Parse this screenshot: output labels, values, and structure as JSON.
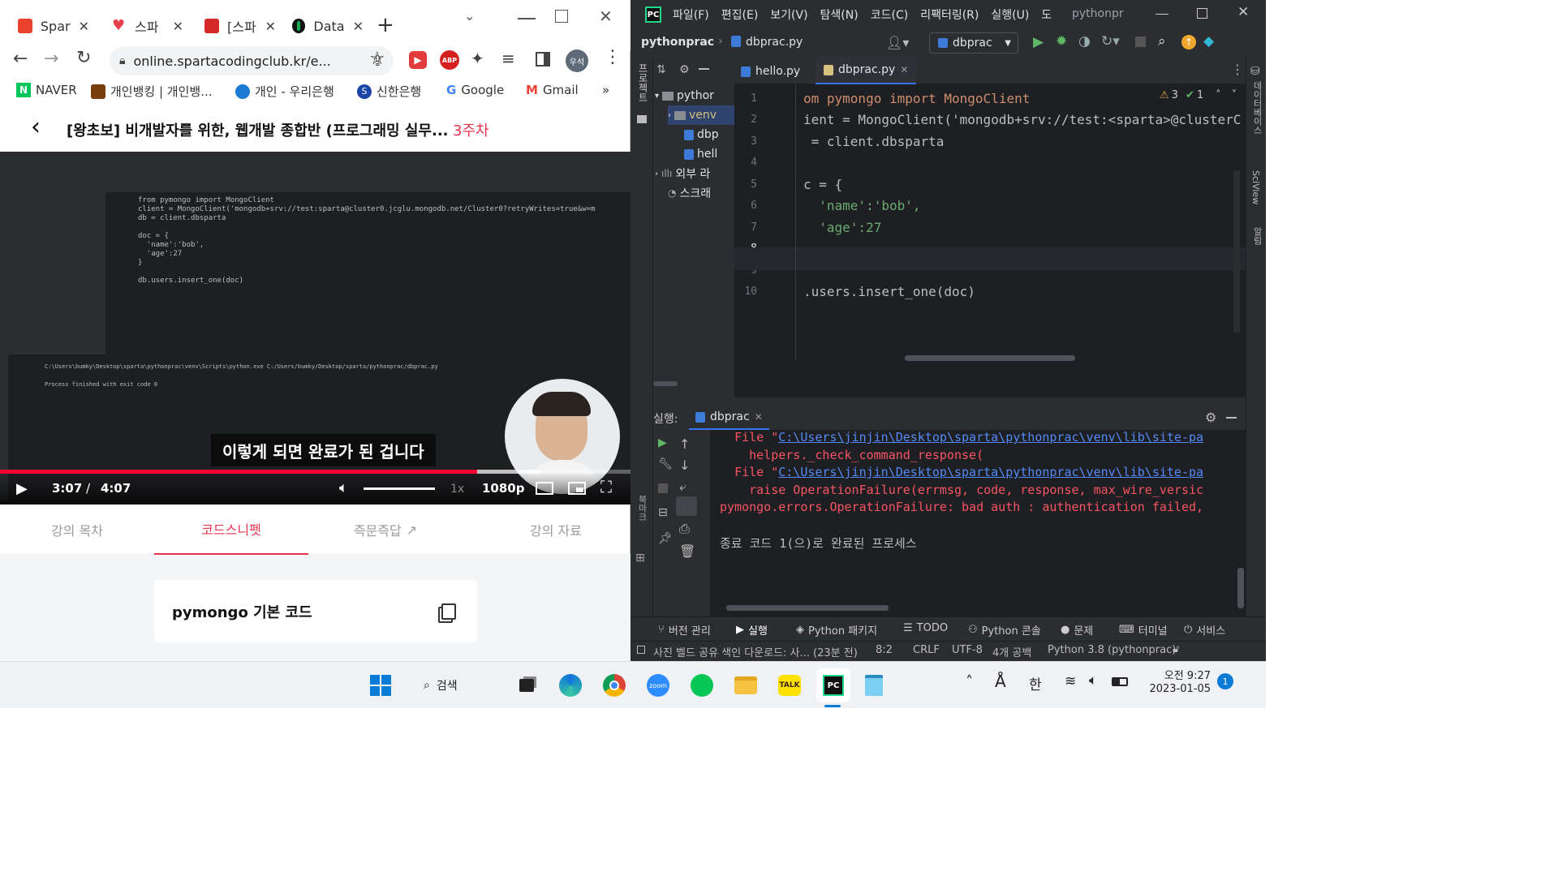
{
  "browser": {
    "tabs": [
      {
        "label": "Spar",
        "color": "#e8412e"
      },
      {
        "label": "스파",
        "color": "#e8414e"
      },
      {
        "label": "[스파",
        "color": "#d42a2a"
      },
      {
        "label": "Data",
        "color": "#0e7a3a"
      }
    ],
    "url": "online.spartacodingclub.kr/e...",
    "profile": "우석",
    "bookmarks": [
      "NAVER",
      "개인뱅킹 | 개인뱅...",
      "개인 - 우리은행",
      "신한은행",
      "Google",
      "Gmail"
    ],
    "bookmarks_more": "»",
    "page_title": "[왕초보] 비개발자를 위한, 웹개발 종합반 (프로그래밍 실무...",
    "week_badge": "3주차",
    "video": {
      "caption": "이렇게 되면 완료가 된 겁니다",
      "time_current": "3:07",
      "time_sep": "/",
      "time_total": "4:07",
      "quality": "1080p",
      "speed": "1x",
      "progress": 0.757,
      "buffered": 0.1,
      "inner_code": [
        "from pymongo import MongoClient",
        "client = MongoClient('mongodb+srv://test:sparta@cluster0.jcglu.mongodb.net/Cluster0?retryWrites=true&w=m",
        "db = client.dbsparta",
        "",
        "doc = {",
        "  'name':'bob',",
        "  'age':27",
        "}",
        "",
        "db.users.insert_one(doc)"
      ],
      "inner_run": [
        "C:\\Users\\bumky\\Desktop\\sparta\\pythonprac\\venv\\Scripts\\python.exe C:/Users/bumky/Desktop/sparta/pythonprac/dbprac.py",
        "",
        "Process finished with exit code 0"
      ]
    },
    "page_tabs": [
      "강의 목차",
      "코드스니펫",
      "즉문즉답",
      "강의 자료"
    ],
    "active_tab": 1,
    "snippet_title": "pymongo 기본 코드"
  },
  "ide": {
    "menu": [
      "파일(F)",
      "편집(E)",
      "보기(V)",
      "탐색(N)",
      "코드(C)",
      "리팩터링(R)",
      "실행(U)",
      "도"
    ],
    "project_name_title": "pythonpr",
    "breadcrumb": [
      "pythonprac",
      "dbprac.py"
    ],
    "run_config": "dbprac",
    "editor_tabs": [
      "hello.py",
      "dbprac.py"
    ],
    "active_editor_tab": 1,
    "project_tree": [
      "pythor",
      "venv",
      "dbp",
      "hell",
      "외부 라",
      "스크래"
    ],
    "left_strip_label": "프로젝트",
    "warnings": "3",
    "checks": "1",
    "code_lines": [
      {
        "n": "1",
        "text": "om pymongo import MongoClient"
      },
      {
        "n": "2",
        "text": "ient = MongoClient('mongodb+srv://test:<sparta>@clusterC"
      },
      {
        "n": "3",
        "text": " = client.dbsparta"
      },
      {
        "n": "4",
        "text": ""
      },
      {
        "n": "5",
        "text": "c = {"
      },
      {
        "n": "6",
        "text": "  'name':'bob',"
      },
      {
        "n": "7",
        "text": "  'age':27"
      },
      {
        "n": "8",
        "text": ""
      },
      {
        "n": "9",
        "text": ""
      },
      {
        "n": "10",
        "text": ".users.insert_one(doc)"
      }
    ],
    "run_label": "실행:",
    "run_tab": "dbprac",
    "run_output": [
      {
        "kind": "file",
        "prefix": "File \"",
        "link": "C:\\Users\\jinjin\\Desktop\\sparta\\pythonprac\\venv\\lib\\site-pa"
      },
      {
        "kind": "err",
        "text": "    helpers._check_command_response("
      },
      {
        "kind": "file",
        "prefix": "File \"",
        "link": "C:\\Users\\jinjin\\Desktop\\sparta\\pythonprac\\venv\\lib\\site-pa"
      },
      {
        "kind": "err",
        "text": "    raise OperationFailure(errmsg, code, response, max_wire_versic"
      },
      {
        "kind": "err",
        "text": "pymongo.errors.OperationFailure: bad auth : authentication failed,"
      },
      {
        "kind": "blank",
        "text": ""
      },
      {
        "kind": "normal",
        "text": "종료 코드 1(으)로 완료된 프로세스"
      }
    ],
    "right_strip": [
      "데이터베이스",
      "SciView",
      "알림"
    ],
    "bottom_tools": [
      "버전 관리",
      "실행",
      "Python 패키지",
      "TODO",
      "Python 콘솔",
      "문제",
      "터미널",
      "서비스"
    ],
    "status_left": "사진 벨드 공유 색인 다운로드: 사... (23분 전)",
    "status_right": [
      "8:2",
      "CRLF",
      "UTF-8",
      "4개 공백",
      "Python 3.8 (pythonprac)"
    ]
  },
  "taskbar": {
    "search_label": "검색",
    "time": "오전 9:27",
    "date": "2023-01-05",
    "notif_count": "1",
    "ime": "한",
    "apps": [
      "windows",
      "search",
      "task-view",
      "edge",
      "chrome",
      "zoom",
      "line",
      "explorer",
      "kakaotalk",
      "pycharm",
      "notepad"
    ]
  }
}
